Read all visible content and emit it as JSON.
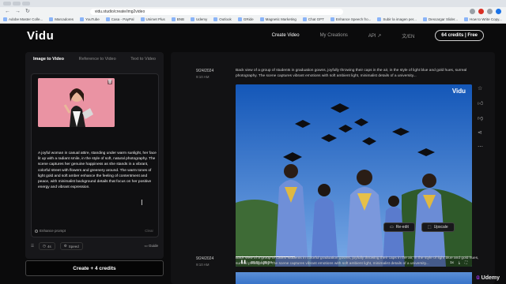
{
  "browser": {
    "url": "vidu.studio/create/img2video",
    "bookmarks": [
      "Adobe Master Colle...",
      "Marcadores",
      "YouTube",
      "Casa - PayPal",
      "Unimet Plus",
      "BNB",
      "Udemy",
      "Outlook",
      "GRide",
      "Magnetic Marketing",
      "Chat GPT",
      "Enhance Speech fro...",
      "Subir la imagen per...",
      "Descargar Slider...",
      "How to Write Copy..."
    ]
  },
  "header": {
    "logo": "Vidu",
    "nav": [
      "Create Video",
      "My Creations",
      "API ↗"
    ],
    "language_icon": "文/EN",
    "credits_label": "64 credits | Free"
  },
  "left": {
    "tabs": [
      "Image to Video",
      "Reference to Video",
      "Text to Video"
    ],
    "prompt": "A joyful woman in casual attire, standing under warm sunlight, her face lit up with a radiant smile, in the style of soft, natural photography. The scene captures her genuine happiness as she stands in a vibrant, colorful street with flowers and greenery around. The warm tones of light gold and soft amber enhance the feeling of contentment and peace, with minimalist background details that focus on her positive energy and vibrant expression.",
    "enhance_label": "Enhance prompt",
    "clear_label": "Clear",
    "duration": "4s",
    "speed": "Speed",
    "guide": "Guide",
    "create_label": "Create + 4 credits"
  },
  "entries": [
    {
      "date": "9/24/2024",
      "time": "9:10 AM",
      "prompt": "Back view of a group of students in graduation gowns, joyfully throwing their caps in the air, in the style of light blue and gold hues, surreal photography. The scene captures vibrant emotions with soft ambient light, minimalist details of a university...",
      "video_watermark": "Vidu",
      "time_code": "00:01 / 00:04",
      "speed_label": "1x",
      "progress": 0.25,
      "reedit_label": "Re-edit",
      "upscale_label": "Upscale"
    },
    {
      "date": "9/24/2024",
      "time": "9:10 AM",
      "prompt": "Back view of a group of Latino students in colorful graduation gowns, joyfully throwing their caps in the air, in the style of light blue and gold hues, surreal photography. The scene captures vibrant emotions with soft ambient light, minimalist details of a university..."
    }
  ],
  "watermark": {
    "brand_u": "ū",
    "brand": "Udemy"
  },
  "colors": {
    "accent": "#ffffff",
    "udemy": "#a435f0",
    "sky": "#2f74d0"
  }
}
